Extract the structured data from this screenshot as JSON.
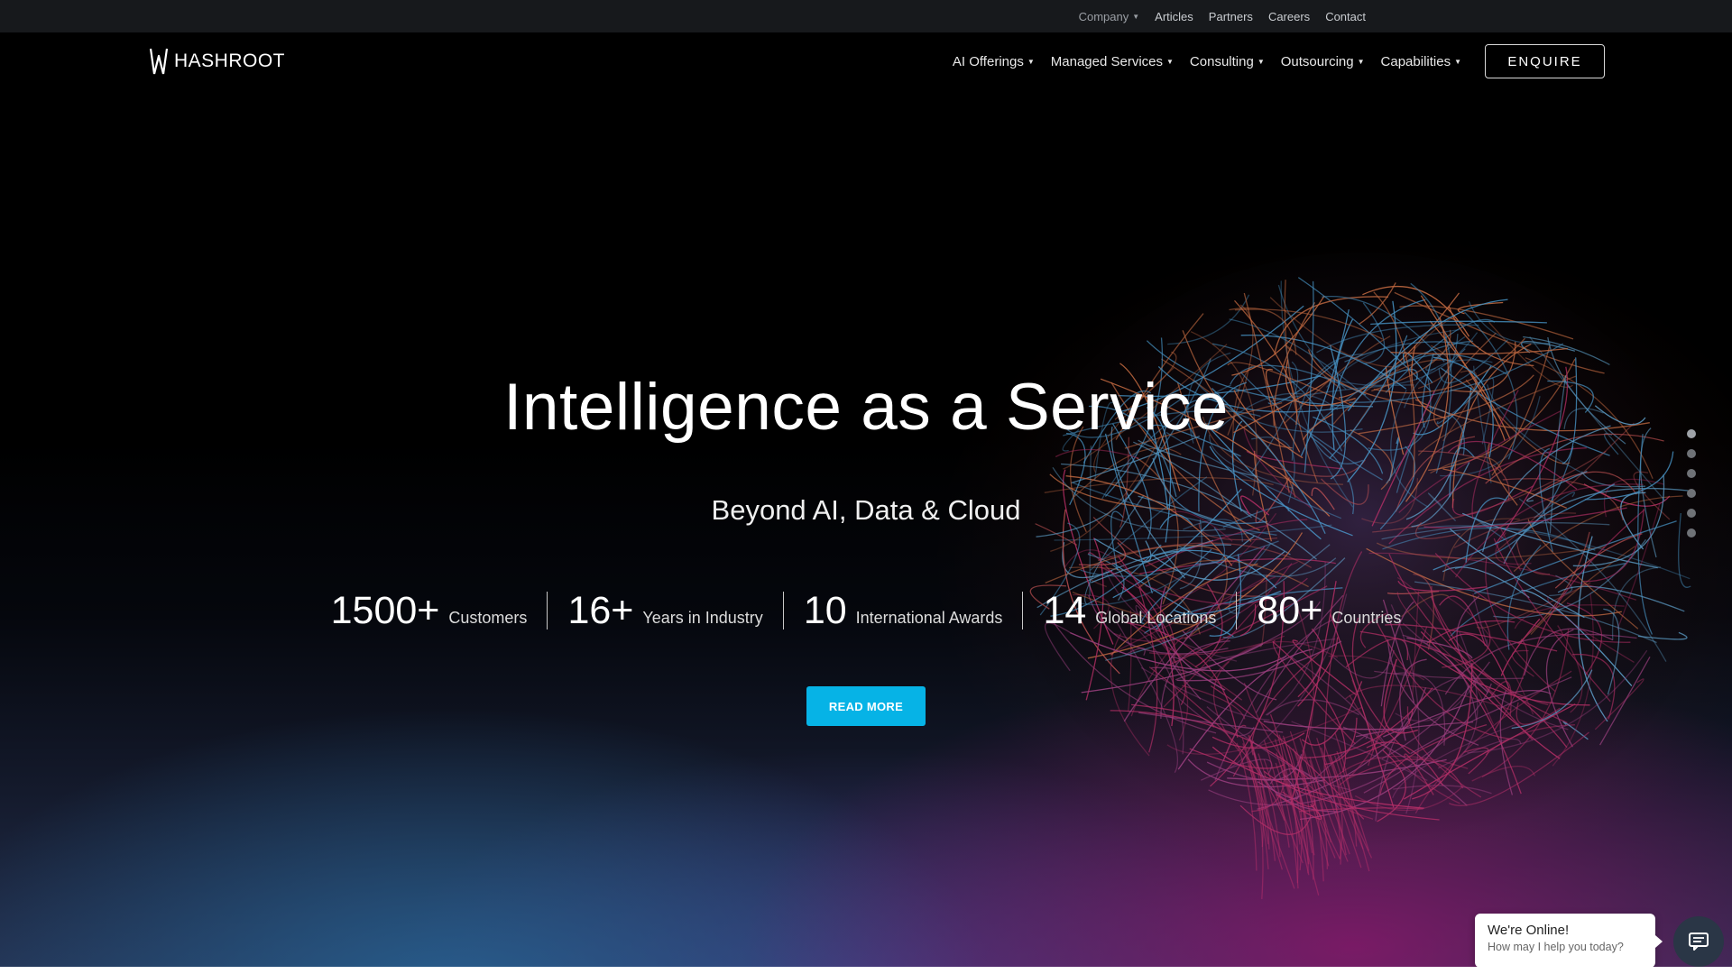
{
  "topbar": {
    "links": [
      {
        "label": "Company",
        "has_caret": true
      },
      {
        "label": "Articles"
      },
      {
        "label": "Partners"
      },
      {
        "label": "Careers"
      },
      {
        "label": "Contact"
      }
    ]
  },
  "header": {
    "logo_text": "HASHROOT",
    "nav": [
      {
        "label": "AI Offerings"
      },
      {
        "label": "Managed Services"
      },
      {
        "label": "Consulting"
      },
      {
        "label": "Outsourcing"
      },
      {
        "label": "Capabilities"
      }
    ],
    "enquire_label": "ENQUIRE"
  },
  "hero": {
    "headline": "Intelligence as a Service",
    "subline": "Beyond AI, Data & Cloud",
    "stats": [
      {
        "num": "1500+",
        "label": "Customers"
      },
      {
        "num": "16+",
        "label": "Years in Industry"
      },
      {
        "num": "10",
        "label": "International Awards"
      },
      {
        "num": "14",
        "label": "Global Locations"
      },
      {
        "num": "80+",
        "label": "Countries"
      }
    ],
    "read_more_label": "READ MORE",
    "slide_count": 6,
    "active_slide": 1
  },
  "chat": {
    "title": "We're Online!",
    "subtitle": "How may I help you today?"
  },
  "colors": {
    "accent": "#06b3e6",
    "topbar_bg": "#17191c",
    "chat_button": "#2a3646"
  }
}
